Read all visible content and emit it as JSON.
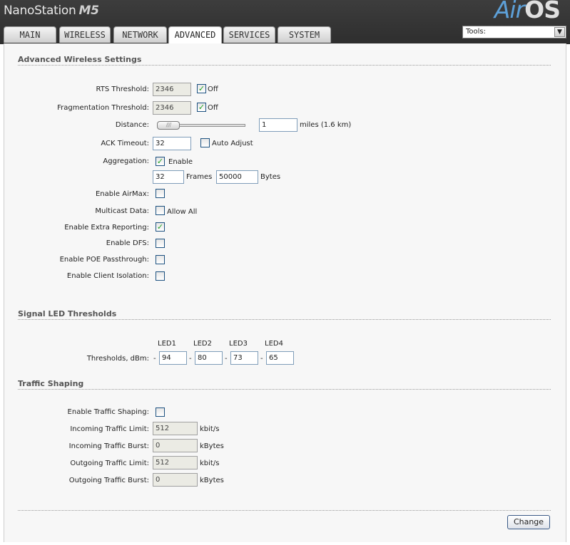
{
  "header": {
    "brand": "NanoStation",
    "model": "M5",
    "logo_air": "Air",
    "logo_os": "OS"
  },
  "tabs": [
    {
      "label": "MAIN"
    },
    {
      "label": "WIRELESS"
    },
    {
      "label": "NETWORK"
    },
    {
      "label": "ADVANCED",
      "active": true
    },
    {
      "label": "SERVICES"
    },
    {
      "label": "SYSTEM"
    }
  ],
  "tools": {
    "label": "Tools:"
  },
  "advanced_wireless": {
    "title": "Advanced Wireless Settings",
    "rts_label": "RTS Threshold:",
    "rts_value": "2346",
    "rts_off_label": "Off",
    "frag_label": "Fragmentation Threshold:",
    "frag_value": "2346",
    "frag_off_label": "Off",
    "distance_label": "Distance:",
    "distance_value": "1",
    "distance_unit": "miles (1.6 km)",
    "ack_label": "ACK Timeout:",
    "ack_value": "32",
    "ack_auto_label": "Auto Adjust",
    "aggregation_label": "Aggregation:",
    "aggregation_enable_label": "Enable",
    "agg_frames_value": "32",
    "agg_frames_label": "Frames",
    "agg_bytes_value": "50000",
    "agg_bytes_label": "Bytes",
    "airmax_label": "Enable AirMax:",
    "multicast_label": "Multicast Data:",
    "multicast_allow_label": "Allow All",
    "extra_reporting_label": "Enable Extra Reporting:",
    "dfs_label": "Enable DFS:",
    "poe_label": "Enable POE Passthrough:",
    "client_iso_label": "Enable Client Isolation:"
  },
  "signal_led": {
    "title": "Signal LED Thresholds",
    "thresholds_label": "Thresholds, dBm:",
    "leds": [
      {
        "name": "LED1",
        "value": "94"
      },
      {
        "name": "LED2",
        "value": "80"
      },
      {
        "name": "LED3",
        "value": "73"
      },
      {
        "name": "LED4",
        "value": "65"
      }
    ],
    "dash": "-"
  },
  "traffic": {
    "title": "Traffic Shaping",
    "enable_label": "Enable Traffic Shaping:",
    "in_limit_label": "Incoming Traffic Limit:",
    "in_limit_value": "512",
    "in_limit_unit": "kbit/s",
    "in_burst_label": "Incoming Traffic Burst:",
    "in_burst_value": "0",
    "in_burst_unit": "kBytes",
    "out_limit_label": "Outgoing Traffic Limit:",
    "out_limit_value": "512",
    "out_limit_unit": "kbit/s",
    "out_burst_label": "Outgoing Traffic Burst:",
    "out_burst_value": "0",
    "out_burst_unit": "kBytes"
  },
  "actions": {
    "change_label": "Change"
  },
  "checks": {
    "rts_off": true,
    "frag_off": true,
    "ack_auto": false,
    "aggregation": true,
    "airmax": false,
    "multicast": false,
    "extra_reporting": true,
    "dfs": false,
    "poe": false,
    "client_iso": false,
    "traffic_shaping": false
  },
  "distance_slider_level": 0.0,
  "colors": {
    "accent": "#5da0d8",
    "check": "#21a121",
    "header": "#333333"
  }
}
